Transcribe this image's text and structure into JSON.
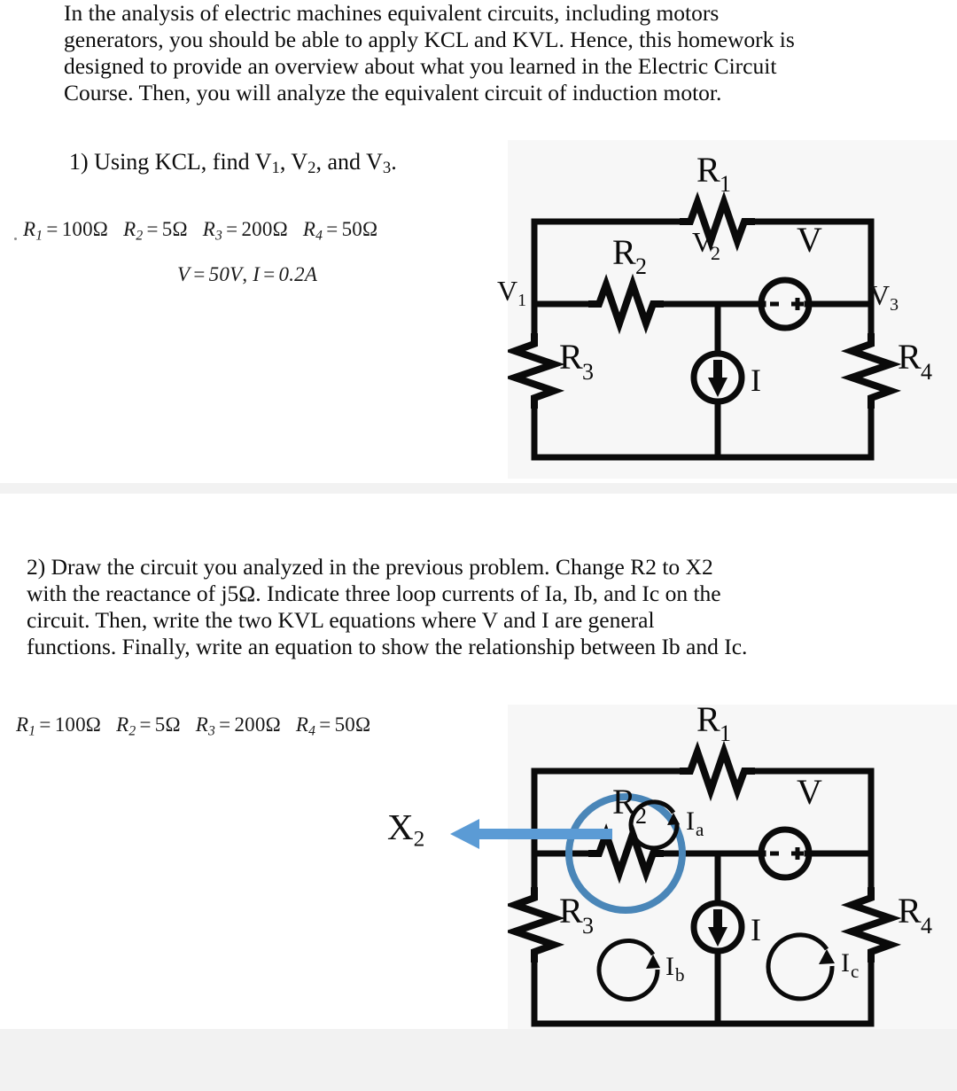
{
  "document": {
    "intro_paragraph": "In the analysis of electric machines equivalent circuits, including motors generators, you should be able to apply KCL and KVL. Hence, this homework is designed to provide an overview about what you learned in the Electric Circuit Course. Then, you will analyze the equivalent circuit of induction motor.",
    "intro_lines": [
      "In  the  analysis  of  electric  machines  equivalent  circuits,  including  motors",
      "generators, you should be able to apply KCL and KVL. Hence, this homework is",
      "designed  to  provide  an  overview  about  what  you  learned  in  the  Electric  Circuit",
      "Course. Then, you will analyze the equivalent circuit of induction motor."
    ]
  },
  "problem1": {
    "heading": "1) Using KCL, find V1, V2, and V3.",
    "heading_parts": {
      "number": "1)",
      "text_before": "Using KCL, find V",
      "v1_sub": "1",
      "mid1": ", V",
      "v2_sub": "2",
      "mid2": ", and V",
      "v3_sub": "3",
      "end": "."
    },
    "given_values": {
      "line1": "R1 = 100Ω   R2 = 5Ω   R3 = 200Ω   R4 = 50Ω",
      "line2": "V = 50V , I = 0.2A",
      "resistors": [
        {
          "symbol": "R",
          "sub": "1",
          "value": "100",
          "unit": "Ω"
        },
        {
          "symbol": "R",
          "sub": "2",
          "value": "5",
          "unit": "Ω"
        },
        {
          "symbol": "R",
          "sub": "3",
          "value": "200",
          "unit": "Ω"
        },
        {
          "symbol": "R",
          "sub": "4",
          "value": "50",
          "unit": "Ω"
        }
      ],
      "sources": [
        {
          "symbol": "V",
          "value": "50V"
        },
        {
          "symbol": "I",
          "value": "0.2A"
        }
      ]
    },
    "circuit": {
      "labels": {
        "r1": "R",
        "r1_sub": "1",
        "r2": "R",
        "r2_sub": "2",
        "r3": "R",
        "r3_sub": "3",
        "r4": "R",
        "r4_sub": "4",
        "v_source": "V",
        "i_source": "I",
        "node_v1": "V",
        "node_v1_sub": "1",
        "node_v2": "V",
        "node_v2_sub": "2",
        "node_v3": "V",
        "node_v3_sub": "3",
        "plus": "+",
        "minus": "−"
      }
    }
  },
  "problem2": {
    "heading_lines": [
      "2)  Draw  the  circuit  you  analyzed  in  the  previous  problem.  Change  R2  to  X2",
      "with  the  reactance  of  j5Ω.  Indicate  three  loop  currents  of  Ia,  Ib,  and  Ic  on  the",
      "circuit.  Then,  write  the  two  KVL  equations  where  V  and  I  are  general",
      "functions. Finally, write an equation to show the relationship between Ib and Ic."
    ],
    "heading_text": "2) Draw the circuit you analyzed in the previous problem. Change R2 to X2 with the reactance of j5Ω. Indicate three loop currents of Ia, Ib, and Ic on the circuit. Then, write the two KVL equations where V and I are general functions. Finally, write an equation to show the relationship between Ib and Ic.",
    "given_values": {
      "line1": "R1 = 100Ω   R2 = 5Ω   R3 = 200Ω   R4 = 50Ω",
      "resistors": [
        {
          "symbol": "R",
          "sub": "1",
          "value": "100",
          "unit": "Ω"
        },
        {
          "symbol": "R",
          "sub": "2",
          "value": "5",
          "unit": "Ω"
        },
        {
          "symbol": "R",
          "sub": "3",
          "value": "200",
          "unit": "Ω"
        },
        {
          "symbol": "R",
          "sub": "4",
          "value": "50",
          "unit": "Ω"
        }
      ]
    },
    "annotation": {
      "label": "X",
      "label_sub": "2",
      "arrow_color": "#5b9bd5",
      "highlight_circle_color": "#4a86b8"
    },
    "circuit": {
      "labels": {
        "r1": "R",
        "r1_sub": "1",
        "r2": "R",
        "r2_sub": "2",
        "r3": "R",
        "r3_sub": "3",
        "r4": "R",
        "r4_sub": "4",
        "v_source": "V",
        "i_source": "I",
        "loop_a": "I",
        "loop_a_sub": "a",
        "loop_b": "I",
        "loop_b_sub": "b",
        "loop_c": "I",
        "loop_c_sub": "c",
        "plus": "+",
        "minus": "−"
      }
    }
  },
  "colors": {
    "page_background": "#ffffff",
    "figure_background": "#f7f7f7",
    "separator_band": "#f2f2f2",
    "ink": "#111111",
    "accent_blue": "#5b9bd5",
    "circle_blue": "#4a86b8"
  }
}
